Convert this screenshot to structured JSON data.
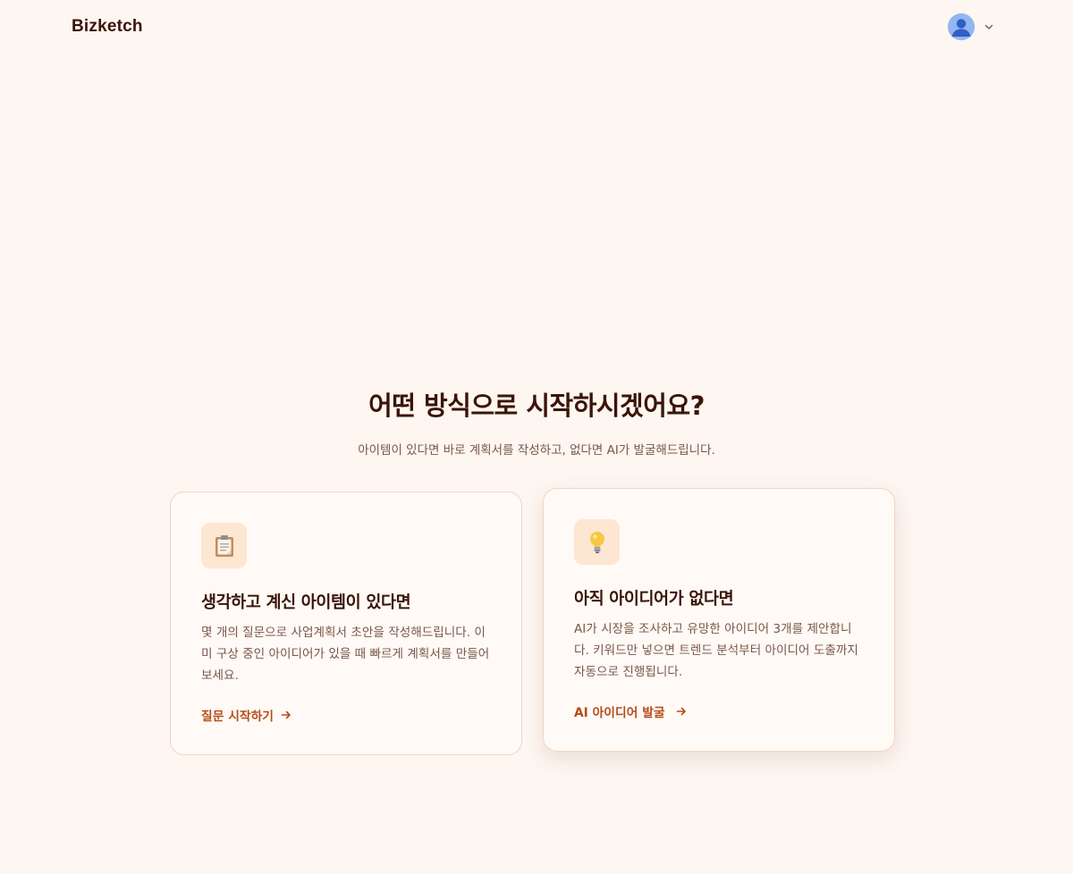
{
  "header": {
    "logo": "Bizketch",
    "avatar_icon": "user-avatar-icon",
    "dropdown_icon": "chevron-down-icon"
  },
  "hero": {
    "title": "어떤 방식으로 시작하시겠어요?",
    "subtitle": "아이템이 있다면 바로 계획서를 작성하고, 없다면 AI가 발굴해드립니다."
  },
  "cards": [
    {
      "icon": "clipboard-icon",
      "title": "생각하고 계신 아이템이 있다면",
      "description": "몇 개의 질문으로 사업계획서 초안을 작성해드립니다. 이미 구상 중인 아이디어가 있을 때 빠르게 계획서를 만들어보세요.",
      "link_label": "질문 시작하기"
    },
    {
      "icon": "lightbulb-icon",
      "title": "아직 아이디어가 없다면",
      "description": "AI가 시장을 조사하고 유망한 아이디어 3개를 제안합니다. 키워드만 넣으면 트렌드 분석부터 아이디어 도출까지 자동으로 진행됩니다.",
      "link_label": "AI 아이디어 발굴"
    }
  ],
  "colors": {
    "background": "#fdf6f1",
    "card_background": "#fffaf6",
    "card_border": "#f1d6c0",
    "icon_tile": "#fde6d2",
    "heading": "#3b1408",
    "body_text": "#7a5748",
    "accent": "#b84a18",
    "avatar": "#93b5f2"
  }
}
